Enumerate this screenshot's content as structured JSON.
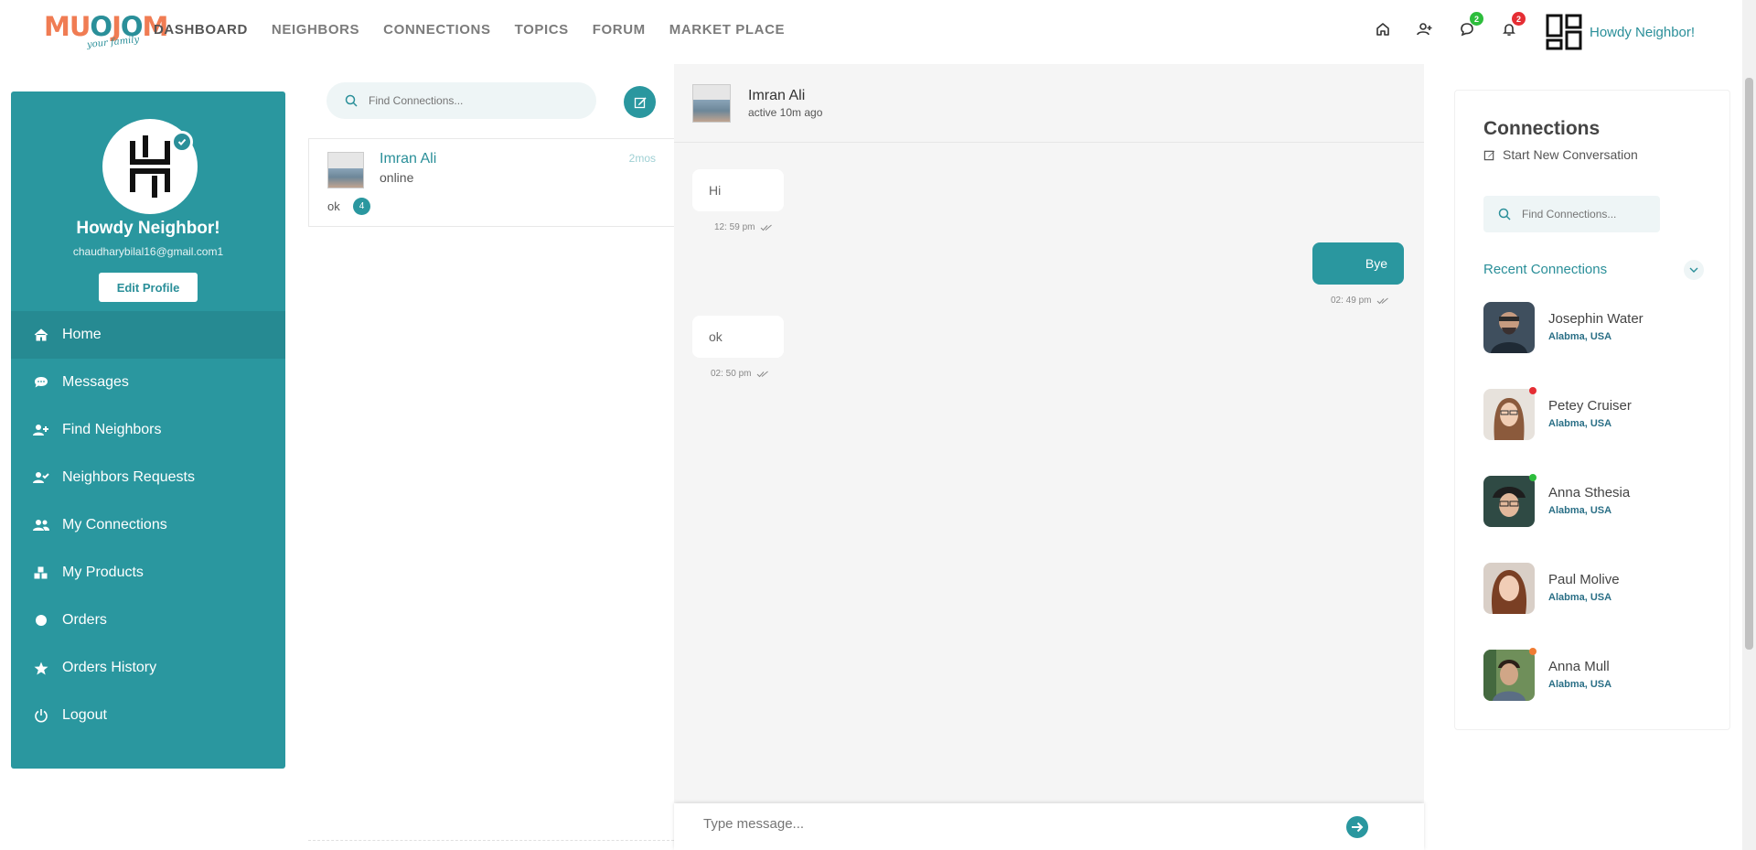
{
  "brand": {
    "name_start": "MU",
    "name_o": "O",
    "name_mid": "J",
    "name_o2": "O",
    "name_end": "M",
    "tagline": "your family"
  },
  "nav": {
    "items": [
      {
        "label": "DASHBOARD"
      },
      {
        "label": "NEIGHBORS"
      },
      {
        "label": "CONNECTIONS"
      },
      {
        "label": "TOPICS"
      },
      {
        "label": "FORUM"
      },
      {
        "label": "MARKET PLACE"
      }
    ],
    "messages_badge": "2",
    "notifications_badge": "2",
    "user_label": "Howdy Neighbor!"
  },
  "profile": {
    "name": "Howdy Neighbor!",
    "email": "chaudharybilal16@gmail.com1",
    "edit_label": "Edit Profile"
  },
  "menu": [
    {
      "label": "Home",
      "icon": "home-icon"
    },
    {
      "label": "Messages",
      "icon": "chat-bubble-icon"
    },
    {
      "label": "Find Neighbors",
      "icon": "user-plus-icon"
    },
    {
      "label": "Neighbors Requests",
      "icon": "user-check-icon"
    },
    {
      "label": "My Connections",
      "icon": "users-icon"
    },
    {
      "label": "My Products",
      "icon": "boxes-icon"
    },
    {
      "label": "Orders",
      "icon": "circle-icon"
    },
    {
      "label": "Orders History",
      "icon": "star-icon"
    },
    {
      "label": "Logout",
      "icon": "power-icon"
    }
  ],
  "conversations": {
    "search_placeholder": "Find Connections...",
    "items": [
      {
        "name": "Imran Ali",
        "status": "online",
        "time": "2mos",
        "preview": "ok",
        "unread": "4"
      }
    ]
  },
  "chat": {
    "contact_name": "Imran Ali",
    "contact_status": "active 10m ago",
    "messages": [
      {
        "direction": "in",
        "text": "Hi",
        "time": "12: 59 pm"
      },
      {
        "direction": "out",
        "text": "Bye",
        "time": "02: 49 pm"
      },
      {
        "direction": "in",
        "text": "ok",
        "time": "02: 50 pm"
      }
    ],
    "compose_placeholder": "Type message..."
  },
  "connections": {
    "title": "Connections",
    "new_label": "Start New Conversation",
    "search_placeholder": "Find Connections...",
    "recent_label": "Recent Connections",
    "people": [
      {
        "name": "Josephin Water",
        "location": "Alabma, USA",
        "status_color": ""
      },
      {
        "name": "Petey Cruiser",
        "location": "Alabma, USA",
        "status_color": "#e52e34"
      },
      {
        "name": "Anna Sthesia",
        "location": "Alabma, USA",
        "status_color": "#2dbd3c"
      },
      {
        "name": "Paul Molive",
        "location": "Alabma, USA",
        "status_color": ""
      },
      {
        "name": "Anna Mull",
        "location": "Alabma, USA",
        "status_color": "#f07c33"
      }
    ]
  },
  "colors": {
    "accent": "#2a979f",
    "brand_orange": "#f07c53"
  }
}
